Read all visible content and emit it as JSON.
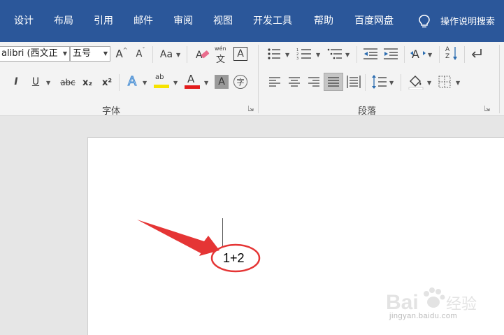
{
  "menu": {
    "items": [
      "设计",
      "布局",
      "引用",
      "邮件",
      "审阅",
      "视图",
      "开发工具",
      "帮助",
      "百度网盘"
    ],
    "search_label": "操作说明搜索"
  },
  "ribbon": {
    "font": {
      "name": "alibri (西文正",
      "size": "五号",
      "group_label": "字体",
      "change_case_label": "Aa",
      "phonetic_top": "wén",
      "phonetic_bottom": "文",
      "border_char": "A",
      "bold_label": "I",
      "underline_label": "U",
      "strike_label": "abc",
      "subscript_label": "x₂",
      "superscript_label": "x²",
      "enclose_char": "字",
      "highlight_label": "ab",
      "font_color_label": "A",
      "shading_label": "A",
      "effects_label": "A",
      "grow_label": "A",
      "shrink_label": "A"
    },
    "paragraph": {
      "group_label": "段落",
      "sort_label": "A Z"
    }
  },
  "document": {
    "text": "1+2"
  },
  "watermark": {
    "brand": "Bai",
    "brand_tail": "经验",
    "url": "jingyan.baidu.com"
  },
  "colors": {
    "menubar": "#2b579a",
    "highlight_yellow": "#f6e300",
    "font_color_red": "#e31c1c",
    "annotation_red": "#e53535",
    "effects_blue": "#4a8fd4"
  }
}
